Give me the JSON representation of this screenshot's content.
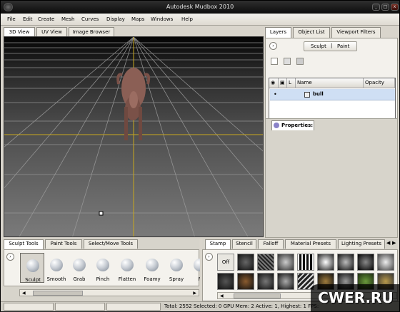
{
  "window": {
    "title": "Autodesk Mudbox 2010",
    "buttons": [
      "_",
      "□",
      "x"
    ]
  },
  "menus": [
    "File",
    "Edit",
    "Create",
    "Mesh",
    "Curves",
    "Display",
    "Maps",
    "Windows",
    "Help"
  ],
  "view_tabs": [
    "3D View",
    "UV View",
    "Image Browser"
  ],
  "right_tabs": [
    "Layers",
    "Object List",
    "Viewport Filters"
  ],
  "sculpt_paint": [
    "Sculpt",
    "Paint"
  ],
  "layer_columns": [
    "Name",
    "Opacity"
  ],
  "layer_row": {
    "name": "bull"
  },
  "properties": {
    "label": "Properties:"
  },
  "bottom_left_tabs": [
    "Sculpt Tools",
    "Paint Tools",
    "Select/Move Tools"
  ],
  "tools": [
    "Sculpt",
    "Smooth",
    "Grab",
    "Pinch",
    "Flatten",
    "Foamy",
    "Spray",
    "R"
  ],
  "bottom_right_tabs": [
    "Stamp",
    "Stencil",
    "Falloff",
    "Material Presets",
    "Lighting Presets"
  ],
  "stamp_off": "Off",
  "status": "Total: 2552  Selected: 0 GPU Mem: 2  Active: 1, Highest: 1  FPS:",
  "watermark": "CWER.RU",
  "icons": {
    "expand": "circle-arrow-icon",
    "scroll_left": "scroll-left-icon",
    "scroll_right": "scroll-right-icon"
  }
}
